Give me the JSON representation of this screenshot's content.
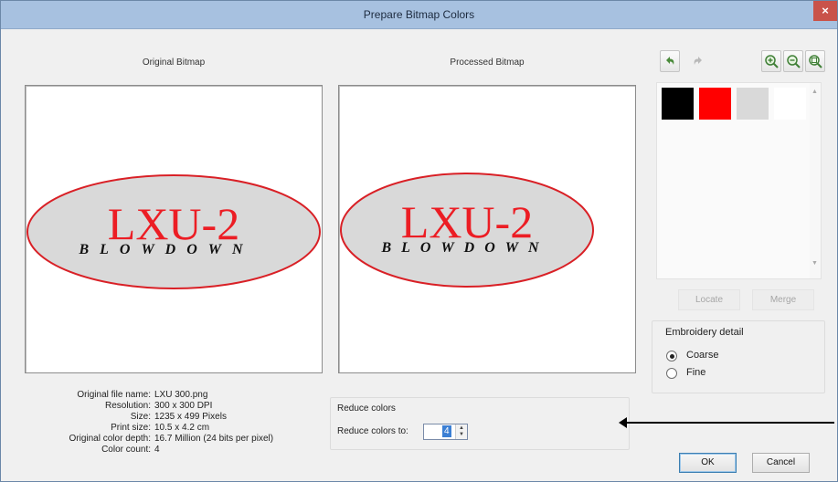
{
  "window": {
    "title": "Prepare Bitmap Colors",
    "close_glyph": "×"
  },
  "panes": {
    "original_label": "Original Bitmap",
    "processed_label": "Processed Bitmap"
  },
  "artwork": {
    "main_text": "LXU-2",
    "sub_text": "BLOWDOWN",
    "text_color": "#ec1d24",
    "ellipse_fill": "#d9d9d9",
    "ellipse_stroke": "#d92026"
  },
  "toolbar": {
    "icons": [
      "undo-icon",
      "redo-icon",
      "zoom-in-icon",
      "zoom-out-icon",
      "zoom-fit-icon"
    ]
  },
  "palette": {
    "swatches": [
      "#000000",
      "#ff0000",
      "#d9d9d9",
      "#ffffff"
    ],
    "locate_label": "Locate",
    "merge_label": "Merge"
  },
  "embroidery": {
    "title": "Embroidery detail",
    "options": [
      {
        "label": "Coarse",
        "selected": true
      },
      {
        "label": "Fine",
        "selected": false
      }
    ]
  },
  "file_info": {
    "rows": [
      {
        "key": "Original file name:",
        "value": "LXU 300.png"
      },
      {
        "key": "Resolution:",
        "value": "300 x 300 DPI"
      },
      {
        "key": "Size:",
        "value": "1235 x 499 Pixels"
      },
      {
        "key": "Print size:",
        "value": "10.5 x 4.2 cm"
      },
      {
        "key": "Original color depth:",
        "value": "16.7 Million (24 bits per pixel)"
      },
      {
        "key": "Color count:",
        "value": "4"
      }
    ]
  },
  "reduce": {
    "title": "Reduce colors",
    "label": "Reduce colors to:",
    "value": "4"
  },
  "buttons": {
    "ok_label": "OK",
    "cancel_label": "Cancel"
  }
}
